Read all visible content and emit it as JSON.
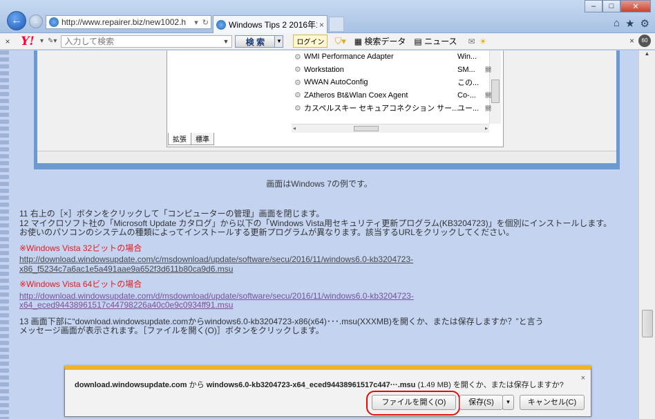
{
  "browser": {
    "url": "http://www.repairer.biz/new1002.h",
    "tab_title": "Windows Tips 2 2016年1...",
    "tab_close": "×",
    "minimize": "‒",
    "maximize": "□",
    "close": "✕",
    "icons": [
      "home-icon",
      "favorites-star-icon",
      "settings-gear-icon"
    ]
  },
  "toolbar": {
    "close": "×",
    "logo": "Y!",
    "search_placeholder": "入力して検索",
    "search_button": "検 索",
    "login": "ログイン",
    "search_data": "検索データ",
    "news": "ニュース",
    "badge": "60"
  },
  "screenshot": {
    "services": [
      {
        "name": "WMI Performance Adapter",
        "desc": "Win...",
        "extra": ""
      },
      {
        "name": "Workstation",
        "desc": "SM...",
        "extra": "關"
      },
      {
        "name": "WWAN AutoConfig",
        "desc": "この...",
        "extra": ""
      },
      {
        "name": "ZAtheros Bt&Wlan Coex Agent",
        "desc": "Co-...",
        "extra": "關"
      },
      {
        "name": "カスペルスキー セキュアコネクション サー...",
        "desc": "ユー...",
        "extra": "關"
      }
    ],
    "tabs": [
      "拡張",
      "標準"
    ]
  },
  "caption": "画面はWindows 7の例です。",
  "steps": {
    "s11": "11 右上の［×］ボタンをクリックして「コンピューターの管理」画面を閉じます。",
    "s12a": "12 マイクロソフト社の「Microsoft Update カタログ」から以下の「Windows Vista用セキュリティ更新プログラム(KB3204723)」を個別にインストールします。",
    "s12b": "お使いのパソコンのシステムの種類によってインストールする更新プログラムが異なります。該当するURLをクリックしてください。",
    "vista32_header": "※Windows Vista 32ビットの場合",
    "vista32_link1": "http://download.windowsupdate.com/c/msdownload/update/software/secu/2016/11/windows6.0-kb3204723-",
    "vista32_link2": "x86_f5234c7a6ac1e5a491aae9a652f3d611b80ca9d6.msu",
    "vista64_header": "※Windows Vista 64ビットの場合",
    "vista64_link1": "http://download.windowsupdate.com/d/msdownload/update/software/secu/2016/11/windows6.0-kb3204723-",
    "vista64_link2": "x64_eced94438961517c44798226a40c0e9c0934ff91.msu",
    "s13a": "13 画面下部に“download.windowsupdate.comからwindows6.0-kb3204723-x86(x64)･･･.msu(XXXMB)を開くか、または保存しますか？”と言う",
    "s13b": "メッセージ画面が表示されます。［ファイルを開く(O)］ボタンをクリックします。"
  },
  "download_bar": {
    "host": "download.windowsupdate.com",
    "from": "から",
    "file": "windows6.0-kb3204723-x64_eced94438961517c447···.msu",
    "size": "(1.49 MB)",
    "question": "を開くか、または保存しますか?",
    "close": "×",
    "open_button": "ファイルを開く(O)",
    "save_button": "保存(S)",
    "cancel_button": "キャンセル(C)"
  },
  "colors": {
    "accent_red": "#e51c1c",
    "page_bg": "#c3d3f0",
    "notify_bar": "#f0b428"
  }
}
